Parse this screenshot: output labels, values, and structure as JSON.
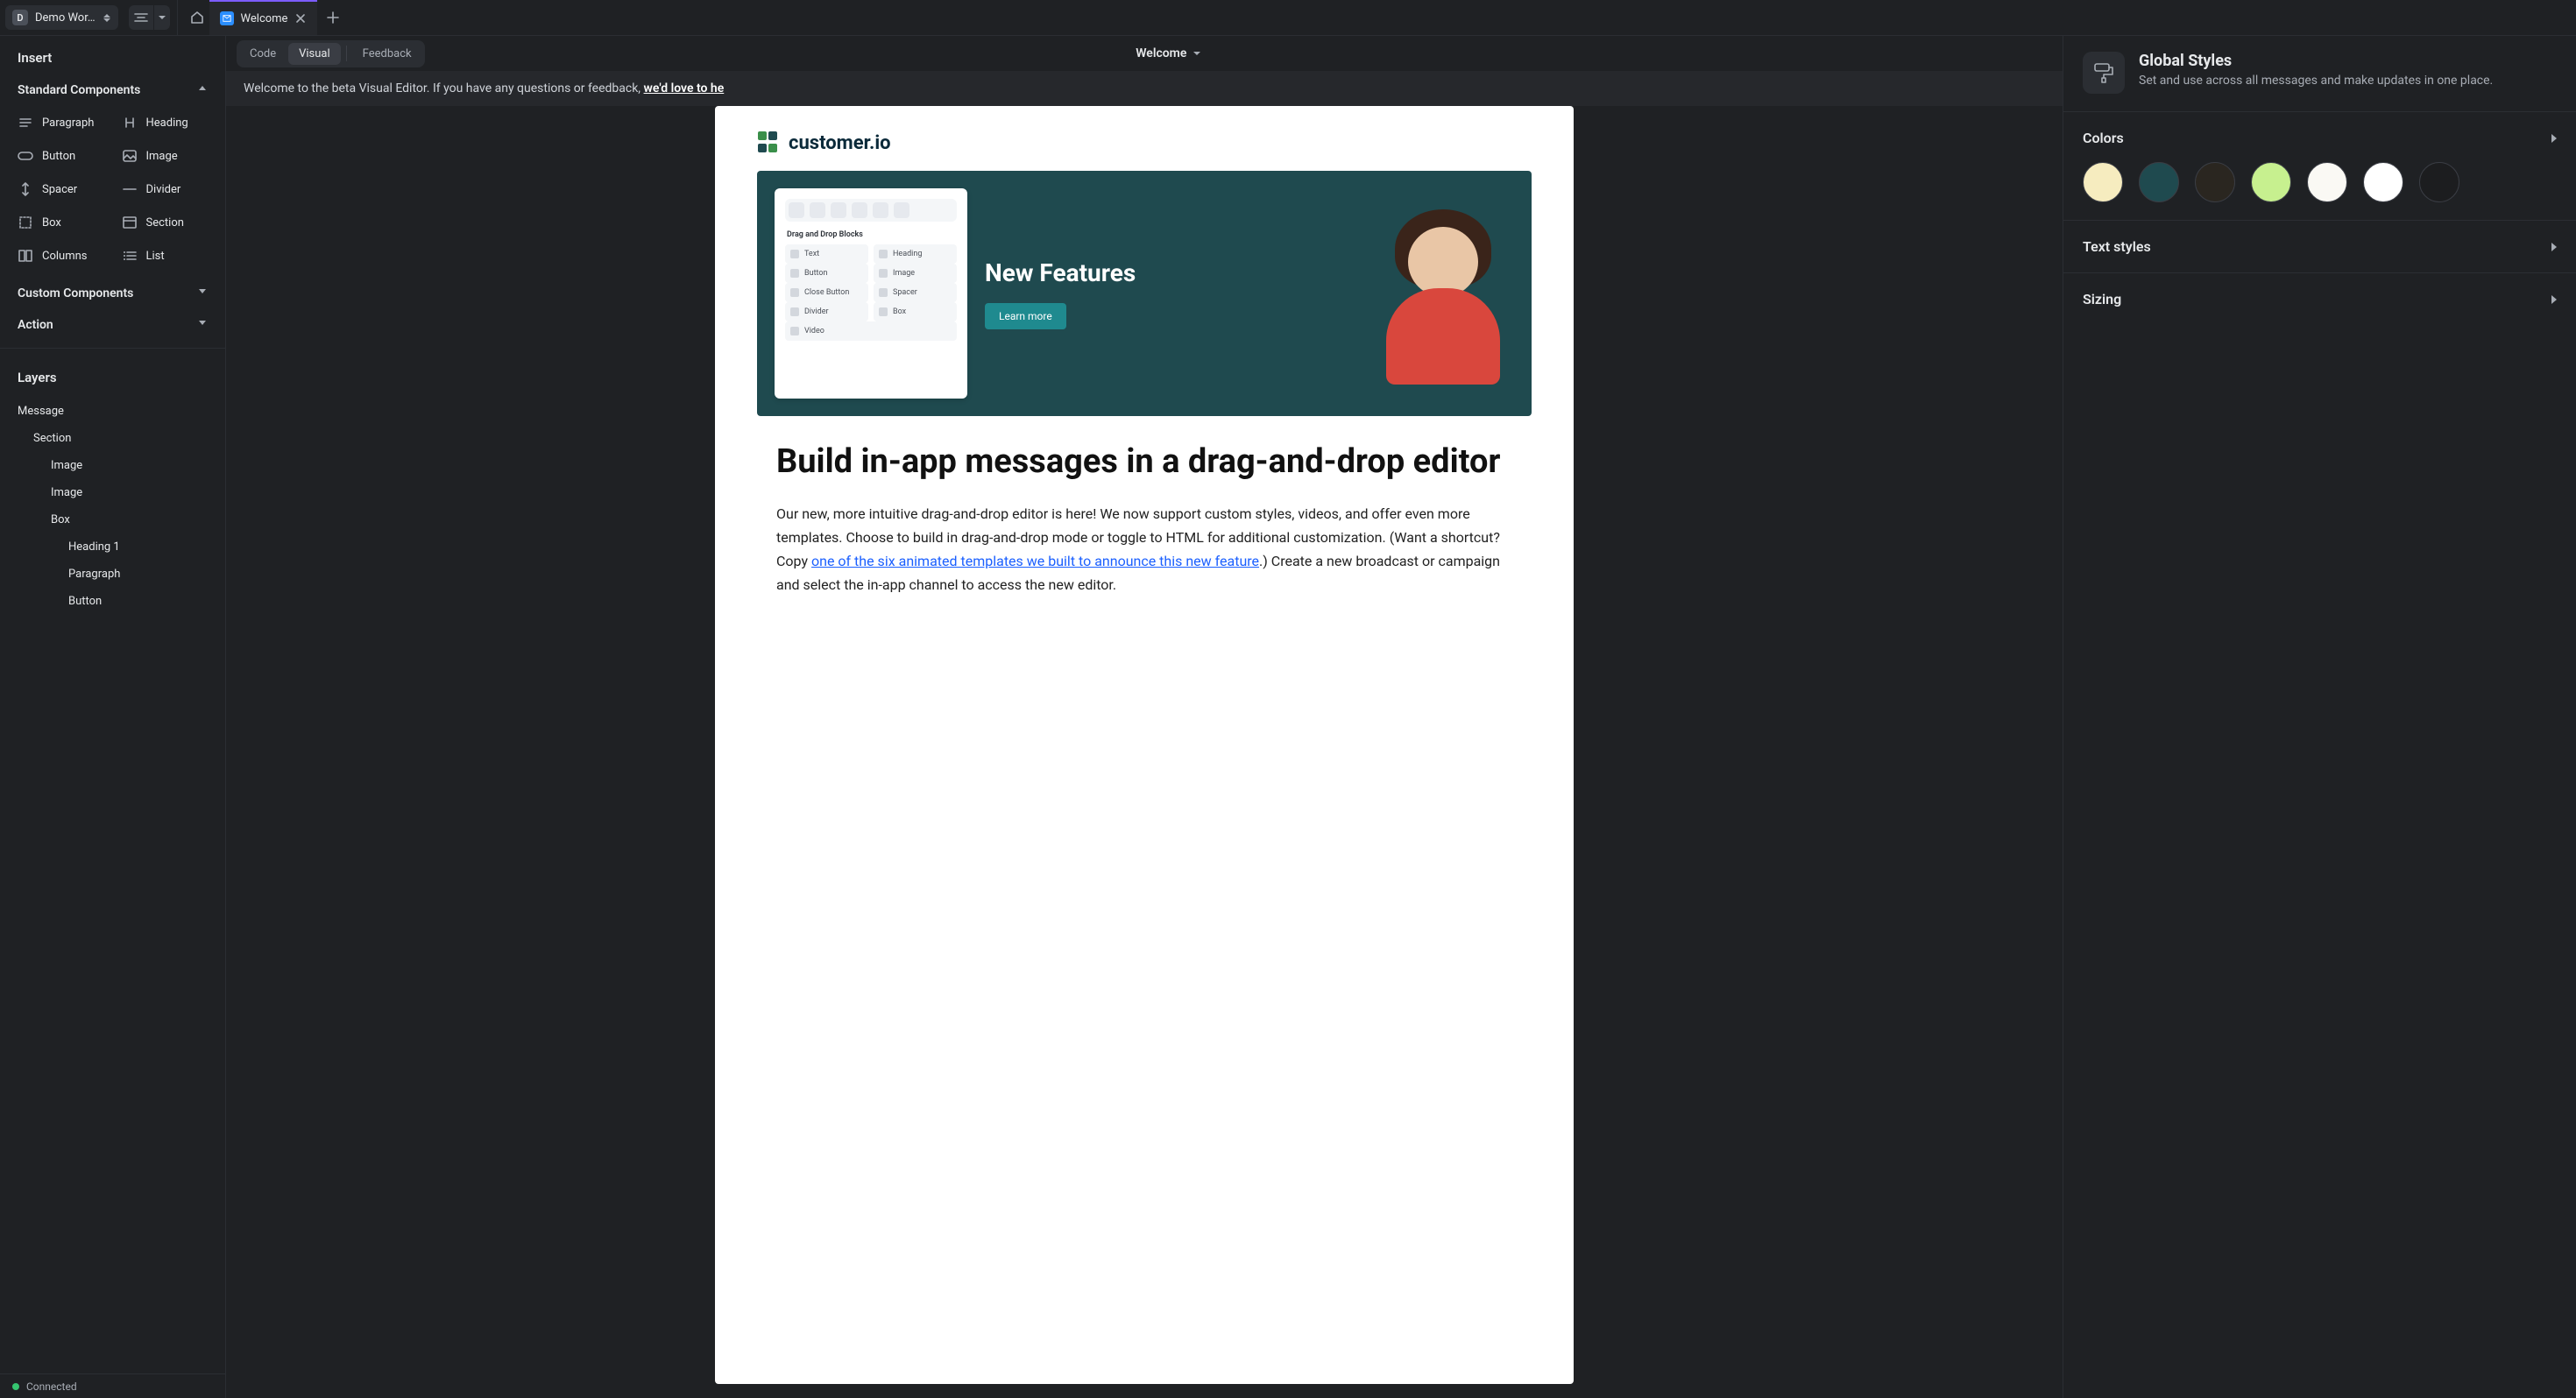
{
  "workspace": {
    "badge": "D",
    "name": "Demo Wor…"
  },
  "tabs": [
    {
      "label": "Welcome"
    }
  ],
  "left": {
    "insert_title": "Insert",
    "layers_title": "Layers",
    "standard_label": "Standard Components",
    "custom_label": "Custom Components",
    "action_label": "Action",
    "components": {
      "paragraph": "Paragraph",
      "heading": "Heading",
      "button": "Button",
      "image": "Image",
      "spacer": "Spacer",
      "divider": "Divider",
      "box": "Box",
      "section": "Section",
      "columns": "Columns",
      "list": "List"
    },
    "layers": [
      {
        "label": "Message",
        "depth": 0
      },
      {
        "label": "Section",
        "depth": 1
      },
      {
        "label": "Image",
        "depth": 2
      },
      {
        "label": "Image",
        "depth": 2
      },
      {
        "label": "Box",
        "depth": 2
      },
      {
        "label": "Heading 1",
        "depth": 3
      },
      {
        "label": "Paragraph",
        "depth": 3
      },
      {
        "label": "Button",
        "depth": 3
      }
    ]
  },
  "toolbar": {
    "code": "Code",
    "visual": "Visual",
    "feedback": "Feedback",
    "title": "Welcome"
  },
  "banner": {
    "text_before": "Welcome to the beta Visual Editor. If you have any questions or feedback, ",
    "link": "we'd love to he",
    "text_after": ""
  },
  "email": {
    "logo_text": "customer.io",
    "hero_panel_title": "Drag and Drop Blocks",
    "hero_chips": [
      "Text",
      "Heading",
      "Button",
      "Image",
      "Close Button",
      "Spacer",
      "Divider",
      "Box",
      "Video"
    ],
    "hero_title": "New Features",
    "hero_button": "Learn more",
    "heading": "Build in-app messages in a drag-and-drop editor",
    "para_before_link": "Our new, more intuitive drag-and-drop editor is here! We now support custom styles, videos, and offer even more templates. Choose to build in drag-and-drop mode or toggle to HTML for additional customization. (Want a shortcut? Copy ",
    "para_link": "one of the six animated templates we built to announce this new feature",
    "para_after_link": ".) Create a new broadcast or campaign and select the in-app channel to access the new editor."
  },
  "right": {
    "title": "Global Styles",
    "subtitle": "Set and use across all messages and make updates in one place.",
    "colors_label": "Colors",
    "text_styles_label": "Text styles",
    "sizing_label": "Sizing",
    "swatches": [
      "#f6ecbf",
      "#1f4a4f",
      "#2a2620",
      "#c7f08f",
      "#faf9f4",
      "#ffffff",
      "#1c1d1f"
    ]
  },
  "status": {
    "connected": "Connected"
  }
}
